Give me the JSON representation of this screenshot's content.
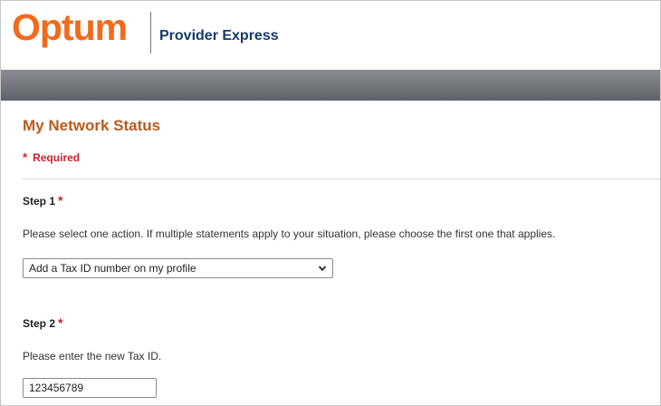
{
  "header": {
    "logo_text": "Optum",
    "product_name": "Provider Express"
  },
  "page": {
    "title": "My Network Status",
    "required_note": "Required",
    "required_star": "*"
  },
  "step1": {
    "label": "Step 1",
    "star": "*",
    "instruction": "Please select one action. If multiple statements apply to your situation, please choose the first one that applies.",
    "selected_option": "Add a Tax ID number on my profile"
  },
  "step2": {
    "label": "Step 2",
    "star": "*",
    "instruction": "Please enter the new Tax ID.",
    "tax_id_value": "123456789"
  },
  "colors": {
    "brand_orange": "#f26a1b",
    "title_orange": "#b95b1c",
    "required_red": "#c8202f",
    "product_navy": "#163a6a"
  },
  "icons": {
    "select_chevron": "chevron-down-icon"
  }
}
